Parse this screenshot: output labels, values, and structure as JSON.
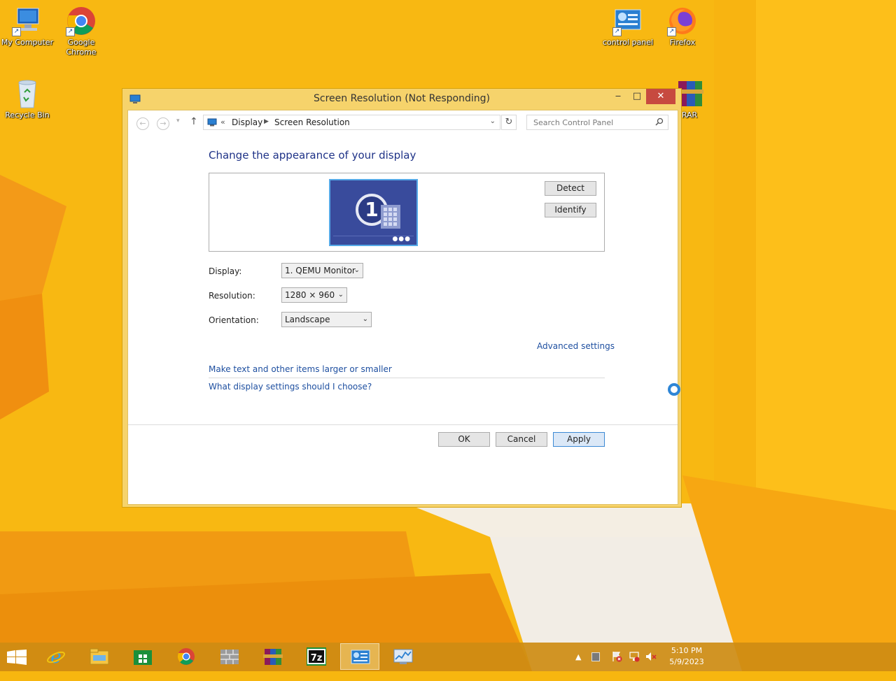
{
  "desktop": {
    "icons": [
      {
        "label": "My Computer"
      },
      {
        "label": "Google Chrome"
      },
      {
        "label": "Recycle Bin"
      },
      {
        "label": "control panel"
      },
      {
        "label": "Firefox"
      },
      {
        "label": "RAR"
      }
    ]
  },
  "window": {
    "title": "Screen Resolution (Not Responding)",
    "controls": {
      "minimize": "‒",
      "maximize": "□",
      "close": "✕"
    },
    "address": {
      "chevron": "«",
      "crumbs": [
        "Display",
        "Screen Resolution"
      ],
      "search_placeholder": "Search Control Panel"
    },
    "heading": "Change the appearance of your display",
    "monitor_number": "1",
    "buttons": {
      "detect": "Detect",
      "identify": "Identify",
      "ok": "OK",
      "cancel": "Cancel",
      "apply": "Apply"
    },
    "fields": {
      "display_label": "Display:",
      "display_value": "1. QEMU Monitor",
      "resolution_label": "Resolution:",
      "resolution_value": "1280 × 960",
      "orientation_label": "Orientation:",
      "orientation_value": "Landscape"
    },
    "links": {
      "advanced": "Advanced settings",
      "text_size": "Make text and other items larger or smaller",
      "what_settings": "What display settings should I choose?"
    }
  },
  "taskbar": {
    "items": [
      "start",
      "internet-explorer",
      "file-explorer",
      "store",
      "chrome",
      "firewall",
      "winrar",
      "7zip",
      "control-panel",
      "performance-monitor"
    ],
    "active_item": "control-panel",
    "clock": {
      "time": "5:10 PM",
      "date": "5/9/2023"
    }
  },
  "colors": {
    "wallpaper": "#f7b60f",
    "window_frame": "#f6d36b",
    "close_button": "#c74a3f",
    "heading": "#1e3287",
    "link": "#1e4fa0"
  }
}
